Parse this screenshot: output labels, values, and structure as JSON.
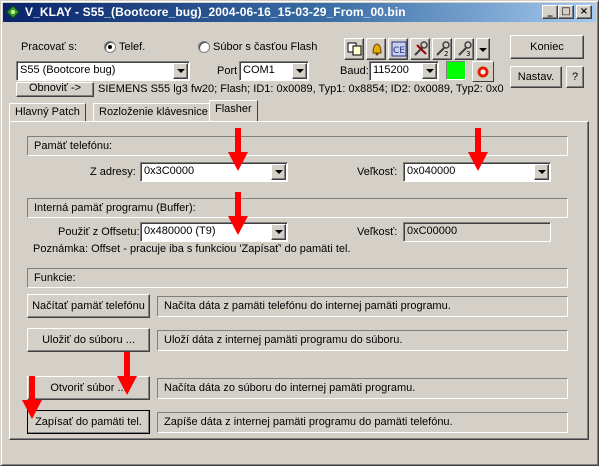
{
  "window": {
    "title": "V_KLAY - S55_(Bootcore_bug)_2004-06-16_15-03-29_From_00.bin",
    "minimize_glyph": "_",
    "maximize_glyph": "□",
    "close_glyph": "×"
  },
  "top": {
    "mode_label": "Pracovať s:",
    "radio_phone": "Telef.",
    "radio_file": "Súbor s časťou Flash",
    "phone_model": "S55 (Bootcore bug)",
    "port_label": "Port",
    "port_value": "COM1",
    "baud_label": "Baud:",
    "baud_value": "115200",
    "refresh_button": "Obnoviť ->",
    "device_info": "SIEMENS S55 lg3 fw20; Flash; ID1: 0x0089, Typ1: 0x8854; ID2: 0x0089, Typ2: 0x0",
    "end_button": "Koniec",
    "settings_button": "Nastav.",
    "help_button": "?",
    "connection_status_color": "#00ff00",
    "toolbar_icons": [
      "copy-icon",
      "bell-icon",
      "ce-icon",
      "tools-1-icon",
      "tools-2-icon",
      "tools-3-icon"
    ]
  },
  "tabs": [
    {
      "label": "Hlavný Patch",
      "active": false
    },
    {
      "label": "Rozloženie klávesnice",
      "active": false
    },
    {
      "label": "Flasher",
      "active": true
    }
  ],
  "flasher": {
    "phone_memory_group": "Pamäť telefónu:",
    "from_address_label": "Z adresy:",
    "from_address_value": "0x3C0000",
    "size_label": "Veľkosť:",
    "size_value": "0x040000",
    "buffer_group": "Interná pamäť programu (Buffer):",
    "offset_label": "Použiť z Offsetu:",
    "offset_value": "0x480000 (T9)",
    "buffer_size_label": "Veľkosť:",
    "buffer_size_value": "0xC00000",
    "note": "Poznámka: Offset - pracuje iba s funkciou 'Zapísať' do pamäti tel.",
    "functions_group": "Funkcie:",
    "functions": [
      {
        "button": "Načítať pamäť telefónu",
        "desc": "Načíta dáta z pamäti telefónu do internej pamäti programu."
      },
      {
        "button": "Uložiť do súboru ...",
        "desc": "Uloží dáta z internej pamäti programu do súboru."
      },
      {
        "button": "Otvoriť súbor ...",
        "desc": "Načíta dáta zo súboru do internej pamäti programu."
      },
      {
        "button": "Zapísať do pamäti tel.",
        "desc": "Zapíše dáta z internej pamäti programu do pamäti telefónu."
      }
    ]
  },
  "annotation_color": "#ff0000"
}
